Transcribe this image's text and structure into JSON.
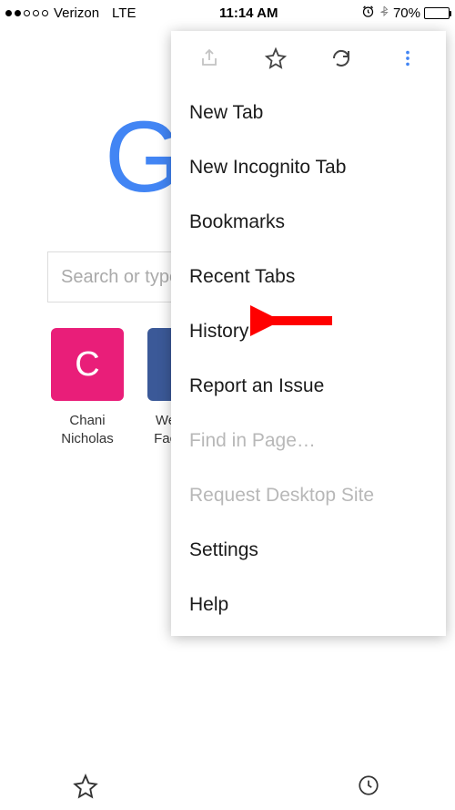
{
  "status_bar": {
    "carrier": "Verizon",
    "network": "LTE",
    "time": "11:14 AM",
    "battery_percent": "70%",
    "signal_filled_dots": 2,
    "signal_total_dots": 5
  },
  "page": {
    "logo_letter": "G",
    "search_placeholder": "Search or type URL",
    "tiles": [
      {
        "letter": "C",
        "color": "pink",
        "label_line1": "Chani",
        "label_line2": "Nicholas"
      },
      {
        "letter": "",
        "color": "blue",
        "label_line1": "Welcome",
        "label_line2": "Facebook"
      }
    ]
  },
  "menu": {
    "icons": {
      "share": "share-icon",
      "star": "star-icon",
      "reload": "reload-icon",
      "more": "more-vertical-icon"
    },
    "items": [
      {
        "label": "New Tab",
        "disabled": false
      },
      {
        "label": "New Incognito Tab",
        "disabled": false
      },
      {
        "label": "Bookmarks",
        "disabled": false
      },
      {
        "label": "Recent Tabs",
        "disabled": false
      },
      {
        "label": "History",
        "disabled": false,
        "highlighted": true
      },
      {
        "label": "Report an Issue",
        "disabled": false
      },
      {
        "label": "Find in Page…",
        "disabled": true
      },
      {
        "label": "Request Desktop Site",
        "disabled": true
      },
      {
        "label": "Settings",
        "disabled": false
      },
      {
        "label": "Help",
        "disabled": false
      }
    ]
  },
  "annotation": {
    "arrow_color": "#ff0000",
    "points_to": "History"
  },
  "bottom_bar": {
    "left_icon": "star-outline-icon",
    "right_icon": "clock-icon"
  }
}
